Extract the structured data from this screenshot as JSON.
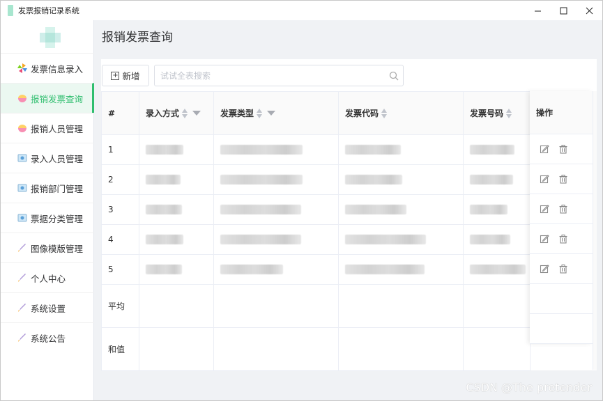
{
  "window": {
    "title": "发票报销记录系统",
    "controls": [
      "—",
      "☐",
      "✕"
    ]
  },
  "sidebar": {
    "items": [
      {
        "label": "发票信息录入",
        "icon": "pinwheel-icon",
        "active": false
      },
      {
        "label": "报销发票查询",
        "icon": "bowl-icon",
        "active": true
      },
      {
        "label": "报销人员管理",
        "icon": "bowl-icon",
        "active": false
      },
      {
        "label": "录入人员管理",
        "icon": "photo-icon",
        "active": false
      },
      {
        "label": "报销部门管理",
        "icon": "photo-icon",
        "active": false
      },
      {
        "label": "票据分类管理",
        "icon": "photo-icon",
        "active": false
      },
      {
        "label": "图像模版管理",
        "icon": "rocket-icon",
        "active": false
      },
      {
        "label": "个人中心",
        "icon": "rocket-icon",
        "active": false
      },
      {
        "label": "系统设置",
        "icon": "rocket-icon",
        "active": false
      },
      {
        "label": "系统公告",
        "icon": "rocket-icon",
        "active": false
      }
    ]
  },
  "page": {
    "title": "报销发票查询"
  },
  "toolbar": {
    "add_label": "新增",
    "search_placeholder": "试试全表搜索"
  },
  "table": {
    "columns": [
      "#",
      "录入方式",
      "发票类型",
      "发票代码",
      "发票号码",
      "操作"
    ],
    "rows": [
      {
        "index": "1"
      },
      {
        "index": "2"
      },
      {
        "index": "3"
      },
      {
        "index": "4"
      },
      {
        "index": "5"
      }
    ],
    "summary": [
      "平均",
      "和值"
    ]
  },
  "watermark": "CSDN @The  pretender",
  "colors": {
    "accent": "#2fbe6e",
    "active_bg": "#ebf8f1"
  }
}
